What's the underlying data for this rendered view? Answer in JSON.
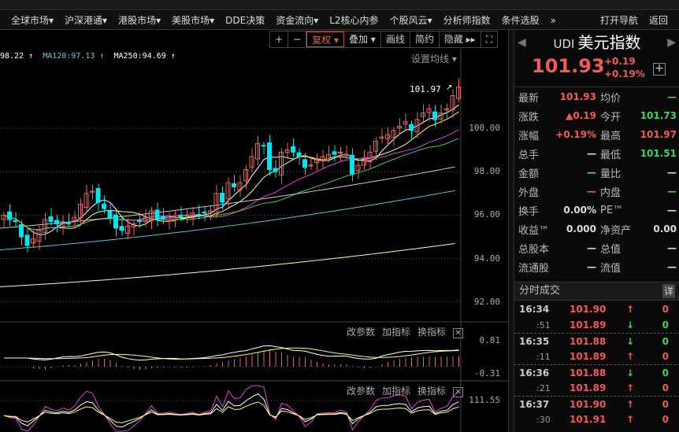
{
  "nav": {
    "items": [
      "全球市场▾",
      "沪深港通▾",
      "港股市场▾",
      "美股市场▾",
      "DDE决策",
      "资金流向▾",
      "L2核心内参",
      "个股风云▾",
      "分析师指数",
      "条件选股",
      "»"
    ],
    "open_nav": "打开导航",
    "back": "返回"
  },
  "toolbar": {
    "plus": "+",
    "minus": "−",
    "fuquan": "复权 ▾",
    "diejia": "叠加 ▾",
    "huaxian": "画线",
    "jianyue": "简约",
    "yincang": "隐藏 ▸▸",
    "fullscreen": "⛶"
  },
  "ma_legend": {
    "ma60": "98.22 ↑",
    "ma120": "MA120:97.13 ↑",
    "ma250": "MA250:94.69 ↑"
  },
  "set_ma": "设置均线 ▾",
  "chart_data": {
    "type": "candlestick",
    "y_ticks": [
      "100.00",
      "98.00",
      "96.00",
      "94.00",
      "92.00"
    ],
    "ylim": [
      91.5,
      102.7
    ],
    "high_label": "101.97",
    "closes": [
      96.0,
      95.8,
      95.7,
      95.0,
      94.6,
      94.9,
      95.3,
      95.8,
      95.7,
      95.6,
      95.7,
      95.6,
      95.9,
      96.5,
      97.0,
      97.1,
      96.6,
      96.3,
      95.9,
      95.4,
      95.3,
      95.5,
      95.6,
      95.7,
      95.9,
      96.2,
      95.8,
      95.8,
      95.9,
      95.9,
      95.9,
      96.0,
      96.1,
      96.0,
      96.1,
      96.2,
      97.0,
      96.6,
      97.5,
      97.3,
      97.5,
      98.1,
      98.7,
      99.3,
      99.2,
      98.1,
      98.0,
      98.9,
      99.0,
      98.9,
      98.7,
      98.2,
      98.3,
      98.6,
      98.7,
      98.8,
      98.8,
      98.9,
      98.8,
      97.9,
      98.3,
      98.6,
      98.9,
      99.4,
      99.6,
      99.7,
      99.9,
      100.1,
      100.3,
      99.9,
      100.4,
      100.7,
      100.9,
      100.4,
      100.7,
      100.9,
      101.5,
      101.9
    ],
    "ma60": [
      95.4,
      98.22
    ],
    "ma120": [
      94.4,
      97.13
    ],
    "ma250": [
      92.7,
      94.69
    ]
  },
  "macd": {
    "tools": [
      "改参数",
      "加指标",
      "换指标"
    ],
    "close": "✕",
    "top": "0.81",
    "bottom": "-0.31"
  },
  "kdj": {
    "tools": [
      "改参数",
      "加指标",
      "换指标"
    ],
    "close": "✕",
    "top": "111.55"
  },
  "quote": {
    "code": "UDI",
    "name": "美元指数",
    "price": "101.93",
    "change": "+0.19",
    "pct": "+0.19%",
    "plus": "+",
    "rows": [
      {
        "l": "最新",
        "v": "101.93",
        "vc": "red",
        "l2": "均价",
        "v2": "—",
        "v2c": "green"
      },
      {
        "l": "涨跌",
        "v": "▲0.19",
        "vc": "red",
        "l2": "今开",
        "v2": "101.73",
        "v2c": "green"
      },
      {
        "l": "涨幅",
        "v": "+0.19%",
        "vc": "red",
        "l2": "最高",
        "v2": "101.97",
        "v2c": "red"
      },
      {
        "l": "总手",
        "v": "—",
        "vc": "white",
        "l2": "最低",
        "v2": "101.51",
        "v2c": "green"
      },
      {
        "l": "金额",
        "v": "—",
        "vc": "cyan",
        "l2": "量比",
        "v2": "—",
        "v2c": "white"
      },
      {
        "l": "外盘",
        "v": "—",
        "vc": "red",
        "l2": "内盘",
        "v2": "—",
        "v2c": "green"
      },
      {
        "l": "换手",
        "v": "0.00%",
        "vc": "white",
        "l2": "PE™",
        "v2": "—",
        "v2c": "white"
      },
      {
        "l": "收益™",
        "v": "0.000",
        "vc": "white",
        "l2": "净资产",
        "v2": "0.00",
        "v2c": "white"
      },
      {
        "l": "总股本",
        "v": "—",
        "vc": "white",
        "l2": "总值",
        "v2": "—",
        "v2c": "white"
      },
      {
        "l": "流通股",
        "v": "—",
        "vc": "white",
        "l2": "流值",
        "v2": "—",
        "v2c": "white"
      }
    ]
  },
  "trades": {
    "title": "分时成交",
    "detail": "详",
    "rows": [
      {
        "t": "16:34",
        "p": "101.90",
        "d": "up",
        "v": "0"
      },
      {
        "t": ":51",
        "p": "101.89",
        "d": "down",
        "v": "0"
      },
      {
        "t": "16:35",
        "p": "101.88",
        "d": "down",
        "v": "0"
      },
      {
        "t": ":11",
        "p": "101.89",
        "d": "up",
        "v": "0"
      },
      {
        "t": "16:36",
        "p": "101.88",
        "d": "down",
        "v": "0"
      },
      {
        "t": ":21",
        "p": "101.89",
        "d": "up",
        "v": "0"
      },
      {
        "t": "16:37",
        "p": "101.90",
        "d": "up",
        "v": "0"
      },
      {
        "t": ":30",
        "p": "101.91",
        "d": "up",
        "v": "0"
      }
    ]
  },
  "colors": {
    "up": "#f25a5a",
    "down": "#3ed45a",
    "bear_candle": "#00e5ee"
  }
}
